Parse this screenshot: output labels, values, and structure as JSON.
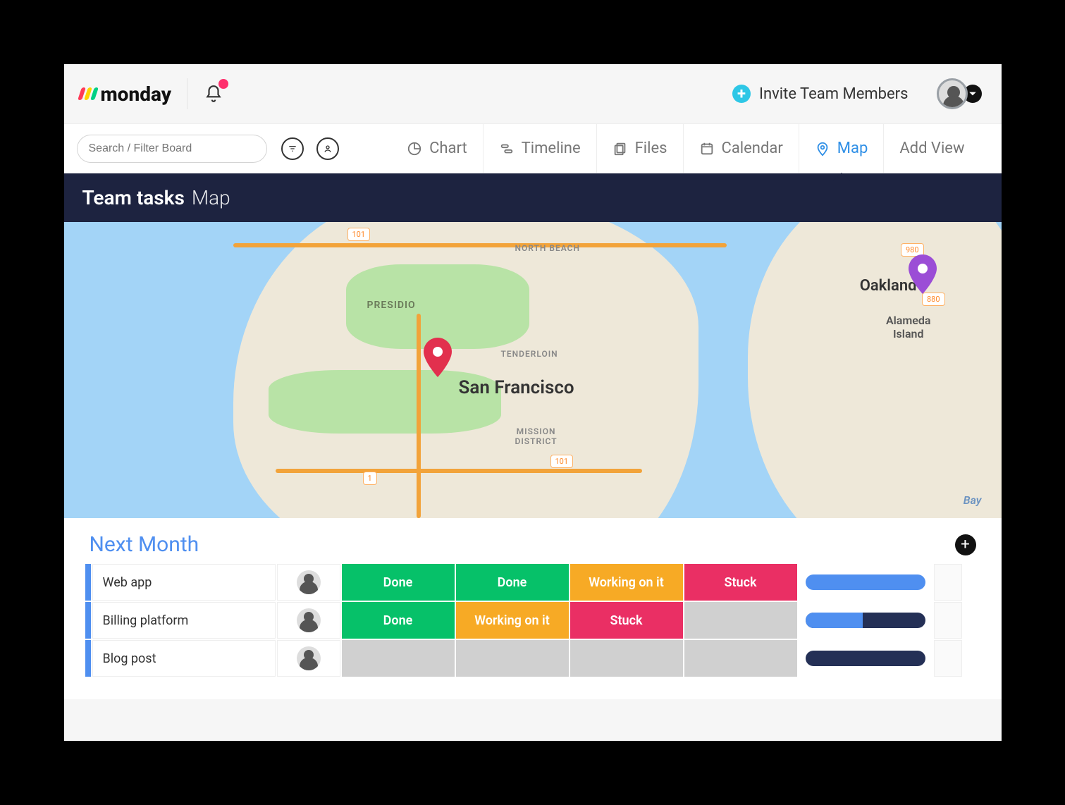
{
  "brand": {
    "name": "monday"
  },
  "header": {
    "invite_label": "Invite Team Members",
    "search_placeholder": "Search / Filter Board",
    "notifications_unread": true
  },
  "views": {
    "tabs": [
      {
        "id": "chart",
        "label": "Chart",
        "icon": "pie-chart-icon"
      },
      {
        "id": "timeline",
        "label": "Timeline",
        "icon": "timeline-icon"
      },
      {
        "id": "files",
        "label": "Files",
        "icon": "files-icon"
      },
      {
        "id": "calendar",
        "label": "Calendar",
        "icon": "calendar-icon"
      },
      {
        "id": "map",
        "label": "Map",
        "icon": "map-pin-icon"
      }
    ],
    "active_id": "map",
    "add_view_label": "Add View"
  },
  "page": {
    "board_name": "Team tasks",
    "view_name": "Map"
  },
  "map": {
    "places": {
      "san_francisco": "San Francisco",
      "oakland": "Oakland",
      "alameda_island": "Alameda\nIsland",
      "presidio": "PRESIDIO",
      "north_beach": "NORTH BEACH",
      "tenderloin": "TENDERLOIN",
      "mission_district": "MISSION\nDISTRICT",
      "bay": "Bay"
    },
    "road_badges": [
      "101",
      "101",
      "1",
      "980",
      "880"
    ],
    "pins": [
      {
        "color": "#e2304e",
        "near": "San Francisco"
      },
      {
        "color": "#9b4dd6",
        "near": "Oakland"
      }
    ]
  },
  "group": {
    "title": "Next Month",
    "status_colors": {
      "Done": "#06c169",
      "Working on it": "#f7aa25",
      "Stuck": "#ea2f64",
      "empty": "#d0d0d0"
    },
    "status_columns": 4,
    "rows": [
      {
        "name": "Web app",
        "avatar": "person-1",
        "statuses": [
          "Done",
          "Done",
          "Working on it",
          "Stuck"
        ],
        "progress_pct": 100
      },
      {
        "name": "Billing platform",
        "avatar": "person-1",
        "statuses": [
          "Done",
          "Working on it",
          "Stuck",
          ""
        ],
        "progress_pct": 48
      },
      {
        "name": "Blog post",
        "avatar": "person-2",
        "statuses": [
          "",
          "",
          "",
          ""
        ],
        "progress_pct": 0
      }
    ]
  }
}
